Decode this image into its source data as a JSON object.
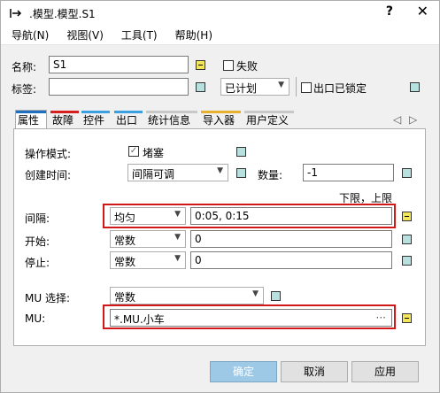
{
  "window": {
    "title": ".模型.模型.S1",
    "help": "?",
    "close": "✕"
  },
  "menu": {
    "items": [
      "导航(N)",
      "视图(V)",
      "工具(T)",
      "帮助(H)"
    ]
  },
  "header": {
    "name_label": "名称:",
    "name_value": "S1",
    "failed_label": "失败",
    "tag_label": "标签:",
    "tag_value": "",
    "status_value": "已计划",
    "exit_locked_label": "出口已锁定"
  },
  "tabs": [
    {
      "label": "属性",
      "color": "#1e6fbf",
      "active": true
    },
    {
      "label": "故障",
      "color": "#d62020"
    },
    {
      "label": "控件",
      "color": "#3aa0e0"
    },
    {
      "label": "出口",
      "color": "#3aa0e0"
    },
    {
      "label": "统计信息",
      "color": "#c8c8c8"
    },
    {
      "label": "导入器",
      "color": "#e8b030"
    },
    {
      "label": "用户定义",
      "color": "#c8c8c8"
    }
  ],
  "tab_nav": {
    "prev": "◁",
    "next": "▷"
  },
  "props": {
    "op_mode_label": "操作模式:",
    "blocking_label": "堵塞",
    "blocking_checked": true,
    "create_time_label": "创建时间:",
    "create_time_value": "间隔可调",
    "quantity_label": "数量:",
    "quantity_value": "-1",
    "limits_label": "下限，上限",
    "interval_label": "间隔:",
    "interval_dist": "均匀",
    "interval_value": "0:05, 0:15",
    "start_label": "开始:",
    "start_dist": "常数",
    "start_value": "0",
    "stop_label": "停止:",
    "stop_dist": "常数",
    "stop_value": "0",
    "mu_select_label": "MU 选择:",
    "mu_select_value": "常数",
    "mu_label": "MU:",
    "mu_value": "*.MU.小车",
    "mu_browse": "···"
  },
  "buttons": {
    "ok": "确定",
    "cancel": "取消",
    "apply": "应用"
  }
}
